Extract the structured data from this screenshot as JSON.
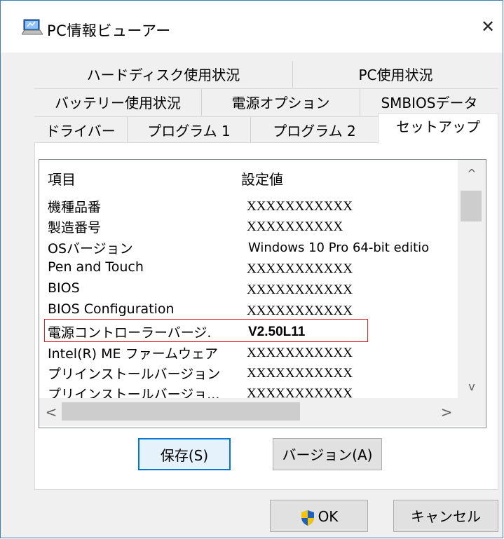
{
  "window": {
    "title": "PC情報ビューアー",
    "close_glyph": "✕"
  },
  "tabs": {
    "row1": [
      "ハードディスク使用状況",
      "PC使用状況"
    ],
    "row2": [
      "バッテリー使用状況",
      "電源オプション",
      "SMBIOSデータ"
    ],
    "row3": [
      "ドライバー",
      "プログラム 1",
      "プログラム 2",
      "セットアップ"
    ],
    "active": "セットアップ"
  },
  "list": {
    "col_item": "項目",
    "col_value": "設定値",
    "rows": [
      {
        "name": "機種品番",
        "value": "XXXXXXXXXXX"
      },
      {
        "name": "製造番号",
        "value": "XXXXXXXXXX"
      },
      {
        "name": "OSバージョン",
        "value": "Windows 10 Pro 64-bit editio"
      },
      {
        "name": " Pen and Touch",
        "value": "XXXXXXXXXXX"
      },
      {
        "name": "BIOS",
        "value": "XXXXXXXXXXX"
      },
      {
        "name": "BIOS Configuration",
        "value": "XXXXXXXXXXX"
      },
      {
        "name": "電源コントローラーバージ.",
        "value": "V2.50L11"
      },
      {
        "name": "Intel(R) ME ファームウェア",
        "value": "XXXXXXXXXXX"
      },
      {
        "name": "プリインストールバージョン",
        "value": "XXXXXXXXXXX"
      },
      {
        "name": "プリインストールバージョ...",
        "value": "XXXXXXXXXXX"
      }
    ],
    "highlight_color": "#e02020"
  },
  "buttons": {
    "save": "保存(S)",
    "version": "バージョン(A)",
    "ok": "OK",
    "cancel": "キャンセル"
  },
  "scroll_glyphs": {
    "up": "^",
    "down": "v",
    "left": "<",
    "right": ">"
  },
  "colors": {
    "accent": "#0078d7",
    "shield_blue": "#1f5fbf",
    "shield_yellow": "#f5c400"
  }
}
